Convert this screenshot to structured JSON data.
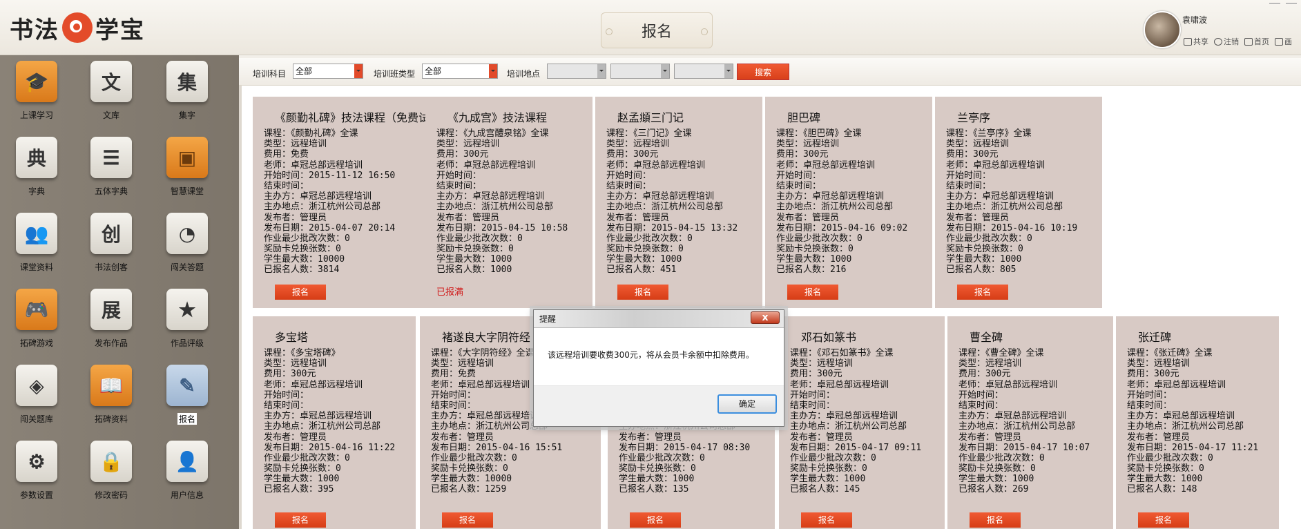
{
  "header": {
    "logo_text_left": "书法",
    "logo_text_right": "学宝",
    "page_title": "报名",
    "username": "袁啸波",
    "links": [
      "共享",
      "注销",
      "首页",
      "画"
    ]
  },
  "sidebar": {
    "items": [
      {
        "label": "上课学习",
        "glyph": "🎓",
        "icon": "graduation-cap-icon",
        "style": "orange"
      },
      {
        "label": "文库",
        "glyph": "文",
        "icon": "wen-icon",
        "style": "light"
      },
      {
        "label": "集字",
        "glyph": "集",
        "icon": "ji-icon",
        "style": "light"
      },
      {
        "label": "字典",
        "glyph": "典",
        "icon": "dian-icon",
        "style": "light"
      },
      {
        "label": "五体字典",
        "glyph": "☰",
        "icon": "notebook-icon",
        "style": "light"
      },
      {
        "label": "智慧课堂",
        "glyph": "▣",
        "icon": "presentation-board-icon",
        "style": "orange"
      },
      {
        "label": "课堂资料",
        "glyph": "👥",
        "icon": "group-icon",
        "style": "light"
      },
      {
        "label": "书法创客",
        "glyph": "创",
        "icon": "chuang-icon",
        "style": "light"
      },
      {
        "label": "闯关答题",
        "glyph": "◔",
        "icon": "target-icon",
        "style": "light"
      },
      {
        "label": "拓碑游戏",
        "glyph": "🎮",
        "icon": "gamepad-icon",
        "style": "orange"
      },
      {
        "label": "发布作品",
        "glyph": "展",
        "icon": "zhan-icon",
        "style": "light"
      },
      {
        "label": "作品评级",
        "glyph": "★",
        "icon": "star-circle-icon",
        "style": "light"
      },
      {
        "label": "闯关题库",
        "glyph": "◈",
        "icon": "layers-icon",
        "style": "light"
      },
      {
        "label": "拓碑资料",
        "glyph": "📖",
        "icon": "book-icon",
        "style": "orange"
      },
      {
        "label": "报名",
        "glyph": "✎",
        "icon": "edit-icon",
        "style": "blue",
        "active": true
      },
      {
        "label": "参数设置",
        "glyph": "⚙",
        "icon": "gear-icon",
        "style": "light"
      },
      {
        "label": "修改密码",
        "glyph": "🔒",
        "icon": "lock-icon",
        "style": "light"
      },
      {
        "label": "用户信息",
        "glyph": "👤",
        "icon": "user-icon",
        "style": "light"
      }
    ]
  },
  "filters": {
    "subject_label": "培训科目",
    "subject_value": "全部",
    "class_type_label": "培训班类型",
    "class_type_value": "全部",
    "location_label": "培训地点",
    "search_label": "搜索"
  },
  "courses": [
    {
      "title": "《颜勤礼碑》技法课程（免费试用）",
      "lines": [
        "课程：《颜勤礼碑》全课",
        "类型：远程培训",
        "费用：免费",
        "老师：卓冠总部远程培训",
        "开始时间：2015-11-12 16:50",
        "结束时间：",
        "主办方：卓冠总部远程培训",
        "主办地点：浙江杭州公司总部",
        "发布者：管理员",
        "发布日期：2015-04-07 20:14",
        "作业最少批改次数：0",
        "奖励卡兑换张数：0",
        "学生最大数：10000",
        "已报名人数：3814"
      ],
      "action": "报名",
      "full": false
    },
    {
      "title": "《九成宫》技法课程",
      "lines": [
        "课程：《九成宫醴泉铭》全课",
        "类型：远程培训",
        "费用：300元",
        "老师：卓冠总部远程培训",
        "开始时间：",
        "结束时间：",
        "主办方：卓冠总部远程培训",
        "主办地点：浙江杭州公司总部",
        "发布者：管理员",
        "发布日期：2015-04-15 10:58",
        "作业最少批改次数：0",
        "奖励卡兑换张数：0",
        "学生最大数：1000",
        "已报名人数：1000"
      ],
      "action": "已报满",
      "full": true
    },
    {
      "title": "赵孟頫三门记",
      "lines": [
        "课程：《三门记》全课",
        "类型：远程培训",
        "费用：300元",
        "老师：卓冠总部远程培训",
        "开始时间：",
        "结束时间：",
        "主办方：卓冠总部远程培训",
        "主办地点：浙江杭州公司总部",
        "发布者：管理员",
        "发布日期：2015-04-15 13:32",
        "作业最少批改次数：0",
        "奖励卡兑换张数：0",
        "学生最大数：1000",
        "已报名人数：451"
      ],
      "action": "报名",
      "full": false
    },
    {
      "title": "胆巴碑",
      "lines": [
        "课程：《胆巴碑》全课",
        "类型：远程培训",
        "费用：300元",
        "老师：卓冠总部远程培训",
        "开始时间：",
        "结束时间：",
        "主办方：卓冠总部远程培训",
        "主办地点：浙江杭州公司总部",
        "发布者：管理员",
        "发布日期：2015-04-16 09:02",
        "作业最少批改次数：0",
        "奖励卡兑换张数：0",
        "学生最大数：1000",
        "已报名人数：216"
      ],
      "action": "报名",
      "full": false
    },
    {
      "title": "兰亭序",
      "lines": [
        "课程：《兰亭序》全课",
        "类型：远程培训",
        "费用：300元",
        "老师：卓冠总部远程培训",
        "开始时间：",
        "结束时间：",
        "主办方：卓冠总部远程培训",
        "主办地点：浙江杭州公司总部",
        "发布者：管理员",
        "发布日期：2015-04-16 10:19",
        "作业最少批改次数：0",
        "奖励卡兑换张数：0",
        "学生最大数：1000",
        "已报名人数：805"
      ],
      "action": "报名",
      "full": false
    },
    {
      "title": "多宝塔",
      "lines": [
        "课程：《多宝塔碑》",
        "类型：远程培训",
        "费用：300元",
        "老师：卓冠总部远程培训",
        "开始时间：",
        "结束时间：",
        "主办方：卓冠总部远程培训",
        "主办地点：浙江杭州公司总部",
        "发布者：管理员",
        "发布日期：2015-04-16 11:22",
        "作业最少批改次数：0",
        "奖励卡兑换张数：0",
        "学生最大数：1000",
        "已报名人数：395"
      ],
      "action": "报名",
      "full": false
    },
    {
      "title": "褚遂良大字阴符经",
      "lines": [
        "课程：《大字阴符经》全课",
        "类型：远程培训",
        "费用：免费",
        "老师：卓冠总部远程培训",
        "开始时间：",
        "结束时间：",
        "主办方：卓冠总部远程培训",
        "主办地点：浙江杭州公司总部",
        "发布者：管理员",
        "发布日期：2015-04-16 15:51",
        "作业最少批改次数：0",
        "奖励卡兑换张数：0",
        "学生最大数：10000",
        "已报名人数：1259"
      ],
      "action": "报名",
      "full": false
    },
    {
      "title": "",
      "lines": [
        "",
        "",
        "",
        "",
        "",
        "",
        "",
        "主办地点：浙江杭州公司总部",
        "发布者：管理员",
        "发布日期：2015-04-17 08:30",
        "作业最少批改次数：0",
        "奖励卡兑换张数：0",
        "学生最大数：1000",
        "已报名人数：135"
      ],
      "action": "报名",
      "full": false
    },
    {
      "title": "邓石如篆书",
      "lines": [
        "课程：《邓石如篆书》全课",
        "类型：远程培训",
        "费用：300元",
        "老师：卓冠总部远程培训",
        "开始时间：",
        "结束时间：",
        "主办方：卓冠总部远程培训",
        "主办地点：浙江杭州公司总部",
        "发布者：管理员",
        "发布日期：2015-04-17 09:11",
        "作业最少批改次数：0",
        "奖励卡兑换张数：0",
        "学生最大数：1000",
        "已报名人数：145"
      ],
      "action": "报名",
      "full": false
    },
    {
      "title": "曹全碑",
      "lines": [
        "课程：《曹全碑》全课",
        "类型：远程培训",
        "费用：300元",
        "老师：卓冠总部远程培训",
        "开始时间：",
        "结束时间：",
        "主办方：卓冠总部远程培训",
        "主办地点：浙江杭州公司总部",
        "发布者：管理员",
        "发布日期：2015-04-17 10:07",
        "作业最少批改次数：0",
        "奖励卡兑换张数：0",
        "学生最大数：1000",
        "已报名人数：269"
      ],
      "action": "报名",
      "full": false
    },
    {
      "title": "张迁碑",
      "lines": [
        "课程：《张迁碑》全课",
        "类型：远程培训",
        "费用：300元",
        "老师：卓冠总部远程培训",
        "开始时间：",
        "结束时间：",
        "主办方：卓冠总部远程培训",
        "主办地点：浙江杭州公司总部",
        "发布者：管理员",
        "发布日期：2015-04-17 11:21",
        "作业最少批改次数：0",
        "奖励卡兑换张数：0",
        "学生最大数：1000",
        "已报名人数：148"
      ],
      "action": "报名",
      "full": false
    }
  ],
  "dialog": {
    "title": "提醒",
    "message": "该远程培训要收费300元，将从会员卡余额中扣除费用。",
    "ok_label": "确定",
    "close_glyph": "x"
  },
  "colors": {
    "accent": "#e24a2a",
    "card_bg": "#d8cac5",
    "full_text": "#d01c1c"
  }
}
